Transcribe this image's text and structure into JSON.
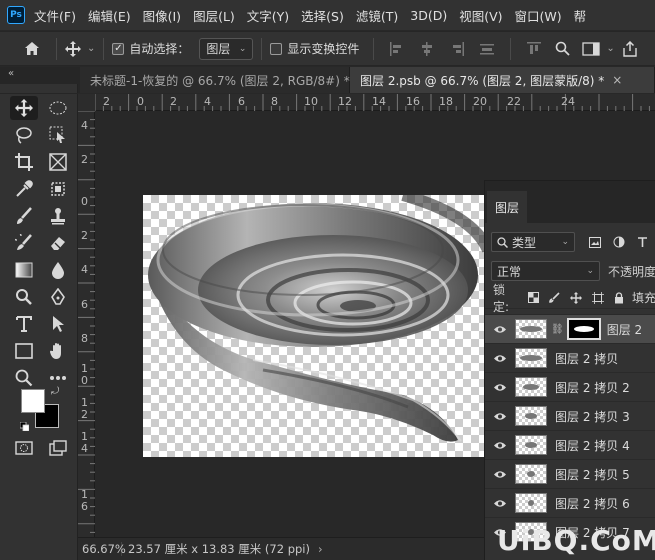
{
  "app": {
    "logo": "Ps"
  },
  "menu": [
    "文件(F)",
    "编辑(E)",
    "图像(I)",
    "图层(L)",
    "文字(Y)",
    "选择(S)",
    "滤镜(T)",
    "3D(D)",
    "视图(V)",
    "窗口(W)",
    "帮"
  ],
  "options": {
    "auto_select_label": "自动选择：",
    "auto_select_target": "图层",
    "show_transform_label": "显示变换控件"
  },
  "tabs": [
    {
      "title": "未标题-1-恢复的 @ 66.7% (图层 2, RGB/8#) *",
      "active": false
    },
    {
      "title": "图层 2.psb @ 66.7% (图层 2, 图层蒙版/8) *",
      "active": true
    }
  ],
  "ruler": {
    "h_labels": [
      "2",
      "0",
      "2",
      "4",
      "6",
      "8",
      "10",
      "12",
      "14",
      "16",
      "18",
      "20",
      "22",
      "24"
    ],
    "v_labels": [
      "4",
      "2",
      "0",
      "2",
      "4",
      "6",
      "8",
      "1\n0",
      "1\n2",
      "1\n4",
      "1\n6"
    ]
  },
  "status": {
    "zoom": "66.67%",
    "doc_size": "23.57 厘米 x 13.83 厘米 (72 ppi)"
  },
  "layers_panel": {
    "tab_label": "图层",
    "filter_kind": "类型",
    "blend_mode": "正常",
    "opacity_label": "不透明度",
    "lock_label": "锁定:",
    "fill_label": "填充",
    "layers": [
      {
        "name": "图层 2",
        "active": true,
        "has_mask": true
      },
      {
        "name": "图层 2 拷贝",
        "active": false
      },
      {
        "name": "图层 2 拷贝 2",
        "active": false
      },
      {
        "name": "图层 2 拷贝 3",
        "active": false
      },
      {
        "name": "图层 2 拷贝 4",
        "active": false
      },
      {
        "name": "图层 2 拷贝 5",
        "active": false
      },
      {
        "name": "图层 2 拷贝 6",
        "active": false
      },
      {
        "name": "图层 2 拷贝 7",
        "active": false
      }
    ]
  },
  "watermark": "UiBQ.CoM",
  "colors": {
    "foreground": "#ffffff",
    "background": "#000000",
    "accent": "#31a8ff"
  }
}
